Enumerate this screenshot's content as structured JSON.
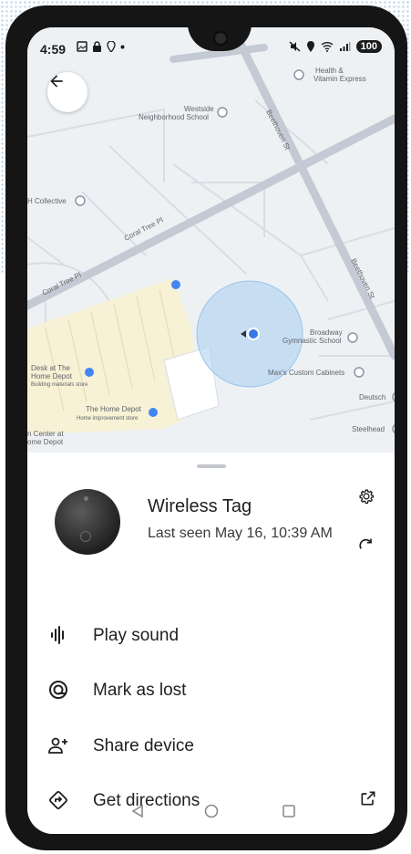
{
  "status_bar": {
    "time": "4:59",
    "battery": "100"
  },
  "map": {
    "labels": {
      "health": "Health &",
      "health2": "Vitamin Express",
      "westside1": "Westside",
      "westside2": "Neighborhood School",
      "collective": "H Collective",
      "coral1": "Coral Tree Pl",
      "coral2": "Coral Tree Pl",
      "beethoven1": "Beethoven St",
      "beethoven2": "Beethoven St",
      "broadway1": "Broadway",
      "broadway2": "Gymnastic School",
      "maxs": "Max's Custom Cabinets",
      "deutsch": "Deutsch",
      "steelhead": "Steelhead",
      "prodesk1": "Desk at The",
      "prodesk2": "Home Depot",
      "prodesk3": "Building materials store",
      "homedepot1": "The Home Depot",
      "homedepot2": "Home improvement store",
      "center1": "n Center at",
      "center2": "ome Depot"
    },
    "colors": {
      "road": "#c3cad3",
      "lot": "#f7f1d6",
      "accuracy": "#a8cdf0",
      "pin": "#3b78e7"
    }
  },
  "device": {
    "name": "Wireless Tag",
    "last_seen": "Last seen May 16, 10:39 AM"
  },
  "actions": [
    {
      "label": "Play sound",
      "icon": "sound-wave-icon"
    },
    {
      "label": "Mark as lost",
      "icon": "lost-target-icon"
    },
    {
      "label": "Share device",
      "icon": "person-add-icon"
    },
    {
      "label": "Get directions",
      "icon": "directions-icon"
    }
  ]
}
